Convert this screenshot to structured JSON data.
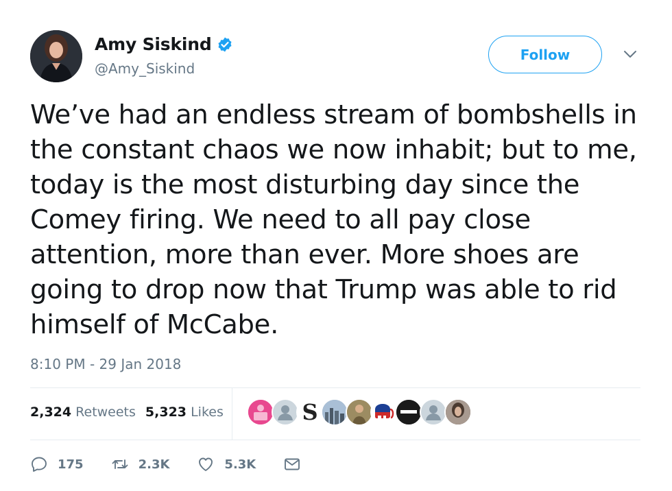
{
  "author": {
    "name": "Amy Siskind",
    "handle": "@Amy_Siskind",
    "verified": true
  },
  "follow_button": {
    "label": "Follow"
  },
  "tweet": {
    "text": "We’ve had an endless stream of bombshells in the constant chaos we now inhabit; but to me, today is the most disturbing day since the Comey firing. We need to all pay close attention, more than ever. More shoes are going to drop now that Trump was able to rid himself of McCabe.",
    "timestamp": "8:10 PM - 29 Jan 2018"
  },
  "stats": {
    "retweets_count": "2,324",
    "retweets_label": "Retweets",
    "likes_count": "5,323",
    "likes_label": "Likes"
  },
  "likers": [
    {
      "icon": "pink-avatar",
      "color": "#e8488f",
      "letter": ""
    },
    {
      "icon": "default-avatar",
      "color": "#ccd6dd",
      "letter": ""
    },
    {
      "icon": "s-logo-avatar",
      "color": "#ffffff",
      "letter": "S"
    },
    {
      "icon": "skyline-avatar",
      "color": "#8aa0b8",
      "letter": ""
    },
    {
      "icon": "outdoor-avatar",
      "color": "#8a7a55",
      "letter": ""
    },
    {
      "icon": "gop-elephant-avatar",
      "color": "#cc2b2b",
      "letter": ""
    },
    {
      "icon": "resist-avatar",
      "color": "#1a1a1a",
      "letter": ""
    },
    {
      "icon": "default-avatar",
      "color": "#ccd6dd",
      "letter": ""
    },
    {
      "icon": "photo-avatar",
      "color": "#5a4a40",
      "letter": ""
    }
  ],
  "actions": {
    "replies": "175",
    "retweets": "2.3K",
    "likes": "5.3K"
  },
  "colors": {
    "accent": "#1da1f2",
    "muted": "#657786",
    "text": "#14171a",
    "divider": "#e6ecf0"
  }
}
